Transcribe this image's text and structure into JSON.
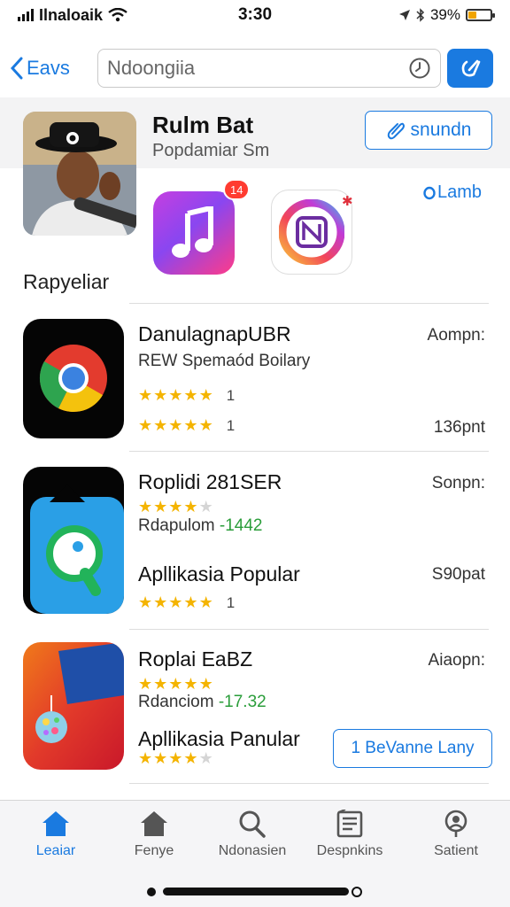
{
  "status_bar": {
    "carrier": "Ilnaloaik",
    "time": "3:30",
    "battery": "39%",
    "battery_level": 0.39
  },
  "header": {
    "back_label": "Eavs",
    "search_value": "Ndoongiia",
    "search_placeholder": "Ndoongiia"
  },
  "featured": {
    "title": "Rulm Bat",
    "subtitle": "Popdamiar Sm",
    "button_label": "snundn",
    "badge_count": "14",
    "link_label": "Lamb"
  },
  "section_title": "Rapyeliar",
  "apps": [
    {
      "name": "DanulagnapUBR",
      "sub_prefix": "REW",
      "subtitle": "Spemaód Boilary",
      "price": "Aompn:",
      "rating1": {
        "stars": 4.5,
        "count": "1"
      },
      "rating2": {
        "stars": 4.5,
        "count": "1"
      },
      "price2": "136pnt"
    },
    {
      "name": "Roplidi 281SER",
      "price": "Sonpn:",
      "rating1": {
        "stars": 4
      },
      "sub_label": "Rdapulom",
      "sub_value": "-1442",
      "name2": "Apllikasia Popular",
      "price2": "S90pat",
      "rating2": {
        "stars": 5,
        "count": "1"
      }
    },
    {
      "name": "Roplai EaBZ",
      "price": "Aiaopn:",
      "rating1": {
        "stars": 4.5
      },
      "sub_label": "Rdanciom",
      "sub_value": "-17.32",
      "name2": "Apllikasia Panular",
      "rating2": {
        "stars": 3.5
      },
      "button_label": "1 BeVanne Lany"
    }
  ],
  "tabs": [
    {
      "label": "Leaiar",
      "icon": "home-icon",
      "active": true
    },
    {
      "label": "Fenye",
      "icon": "home-icon",
      "active": false
    },
    {
      "label": "Ndonasien",
      "icon": "search-icon",
      "active": false
    },
    {
      "label": "Despnkins",
      "icon": "book-icon",
      "active": false
    },
    {
      "label": "Satient",
      "icon": "person-search-icon",
      "active": false
    }
  ],
  "colors": {
    "accent": "#1a7ae0",
    "star": "#f4b400",
    "badge": "#ff3b30",
    "green": "#2a9d3a"
  }
}
